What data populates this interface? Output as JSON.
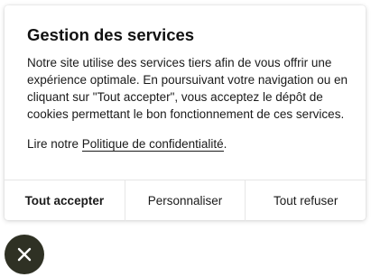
{
  "dialog": {
    "title": "Gestion des services",
    "description": "Notre site utilise des services tiers afin de vous offrir une expérience optimale. En poursuivant votre navigation ou en cliquant sur \"Tout accepter\", vous acceptez le dépôt de cookies permettant le bon fonctionnement de ces services.",
    "policy_prefix": "Lire notre ",
    "policy_link": "Politique de confidentialité",
    "policy_suffix": "."
  },
  "actions": {
    "accept_all": "Tout accepter",
    "customize": "Personnaliser",
    "refuse_all": "Tout refuser"
  },
  "close_button": {
    "icon": "close-icon",
    "background": "#2f3124",
    "icon_color": "#ffffff"
  }
}
